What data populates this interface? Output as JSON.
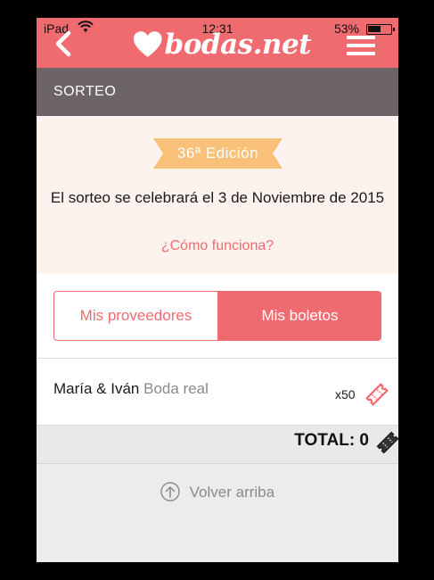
{
  "status_bar": {
    "carrier": "iPad",
    "time": "12:31",
    "battery": "53%"
  },
  "header": {
    "logo_text": "bodas.net",
    "section_title": "SORTEO",
    "icons": {
      "back": "chevron-left-icon",
      "logo": "heart-icon",
      "menu": "hamburger-menu-icon"
    }
  },
  "edition": {
    "badge": "36ª Edición",
    "draw_text": "El sorteo se celebrará el 3 de Noviembre de 2015",
    "how_link": "¿Cómo funciona?"
  },
  "tabs": [
    {
      "label": "Mis proveedores",
      "active": false
    },
    {
      "label": "Mis boletos",
      "active": true
    }
  ],
  "tickets": [
    {
      "name": "María & Iván",
      "tag": "Boda real",
      "count": "x50"
    }
  ],
  "total": "TOTAL: 0",
  "back_to_top": "Volver arriba",
  "colors": {
    "brand": "#f06b70",
    "section_bar": "#6c6467",
    "badge": "#f9c07a",
    "panel": "#fdf3ee"
  }
}
